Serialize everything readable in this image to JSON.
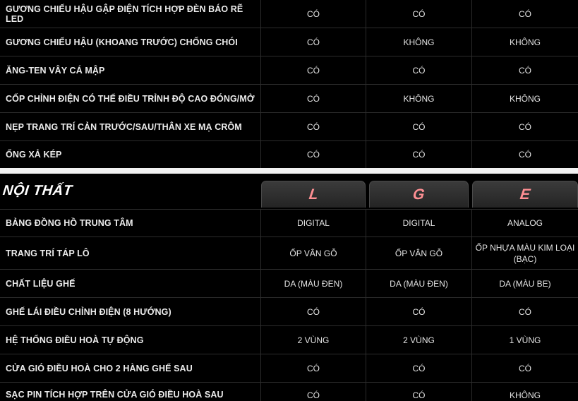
{
  "exterior": {
    "rows": [
      {
        "label": "GƯƠNG CHIẾU HẬU GẬP ĐIỆN TÍCH HỢP ĐÈN BÁO RẼ LED",
        "l": "CÓ",
        "g": "CÓ",
        "e": "CÓ"
      },
      {
        "label": "GƯƠNG CHIẾU HẬU (KHOANG TRƯỚC) CHỐNG CHÓI",
        "l": "CÓ",
        "g": "KHÔNG",
        "e": "KHÔNG"
      },
      {
        "label": "ĂNG-TEN VÂY CÁ MẬP",
        "l": "CÓ",
        "g": "CÓ",
        "e": "CÓ"
      },
      {
        "label": "CỐP CHỈNH ĐIỆN CÓ THỂ ĐIỀU TRỈNH ĐỘ CAO ĐÓNG/MỞ",
        "l": "CÓ",
        "g": "KHÔNG",
        "e": "KHÔNG"
      },
      {
        "label": "NẸP TRANG TRÍ CẢN TRƯỚC/SAU/THÂN XE MẠ CRÔM",
        "l": "CÓ",
        "g": "CÓ",
        "e": "CÓ"
      },
      {
        "label": "ỐNG XẢ KÉP",
        "l": "CÓ",
        "g": "CÓ",
        "e": "CÓ"
      }
    ]
  },
  "interior": {
    "title": "NỘI THẤT",
    "grades": [
      "L",
      "G",
      "E"
    ],
    "grade_color": "#ff8f93",
    "rows": [
      {
        "label": "BẢNG ĐỒNG HỒ TRUNG TÂM",
        "l": "DIGITAL",
        "g": "DIGITAL",
        "e": "ANALOG"
      },
      {
        "label": "TRANG TRÍ TÁP LÔ",
        "l": "ỐP VÂN GỖ",
        "g": "ỐP VÂN GỖ",
        "e": "ỐP NHỰA MÀU KIM LOẠI (BẠC)"
      },
      {
        "label": "CHẤT LIỆU GHẾ",
        "l": "DA (MÀU ĐEN)",
        "g": "DA (MÀU ĐEN)",
        "e": "DA (MÀU BE)"
      },
      {
        "label": "GHẾ LÁI ĐIỀU CHỈNH ĐIỆN (8 HƯỚNG)",
        "l": "CÓ",
        "g": "CÓ",
        "e": "CÓ"
      },
      {
        "label": "HỆ THỐNG ĐIỀU HOÀ TỰ ĐỘNG",
        "l": "2 VÙNG",
        "g": "2 VÙNG",
        "e": "1 VÙNG"
      },
      {
        "label": "CỬA GIÓ ĐIỀU HOÀ CHO 2 HÀNG GHẾ SAU",
        "l": "CÓ",
        "g": "CÓ",
        "e": "CÓ"
      },
      {
        "label": "SẠC PIN TÍCH HỢP TRÊN CỬA GIÓ ĐIỀU HOÀ SAU",
        "l": "CÓ",
        "g": "CÓ",
        "e": "KHÔNG"
      }
    ]
  }
}
